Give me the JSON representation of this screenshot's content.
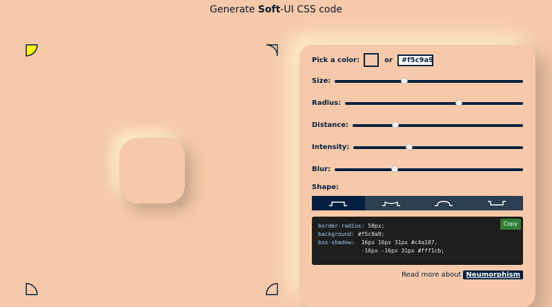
{
  "header": {
    "subtitle_prefix": "Generate ",
    "subtitle_bold": "Soft",
    "subtitle_suffix": "-UI CSS code"
  },
  "colors": {
    "background": "#f5c9a9",
    "dark_shadow": "#c4a187",
    "light_shadow": "#fff1cb",
    "accent": "#001f3f",
    "corner_active": "#ffff00"
  },
  "controls": {
    "color_label": "Pick a color:",
    "or_label": "or",
    "color_value": "#f5c9a9",
    "size_label": "Size:",
    "size_fraction": 0.37,
    "radius_label": "Radius:",
    "radius_fraction": 0.64,
    "distance_label": "Distance:",
    "distance_fraction": 0.25,
    "intensity_label": "Intensity:",
    "intensity_fraction": 0.33,
    "blur_label": "Blur:",
    "blur_fraction": 0.32,
    "shape_label": "Shape:",
    "shapes": [
      "flat-icon",
      "concave-icon",
      "convex-icon",
      "pressed-icon"
    ],
    "active_shape": 0
  },
  "code": {
    "line1_prop": "border-radius:",
    "line1_val": " 50px;",
    "line2_prop": "background:",
    "line2_val": " #f5c9a9;",
    "line3_prop": "box-shadow:",
    "line3_val": "  16px 16px 31px #c4a187,",
    "line4_val": "             -16px -16px 31px #fff1cb;",
    "copy_label": "Copy"
  },
  "footer": {
    "read_more": "Read more about",
    "link": "Neumorphism"
  }
}
